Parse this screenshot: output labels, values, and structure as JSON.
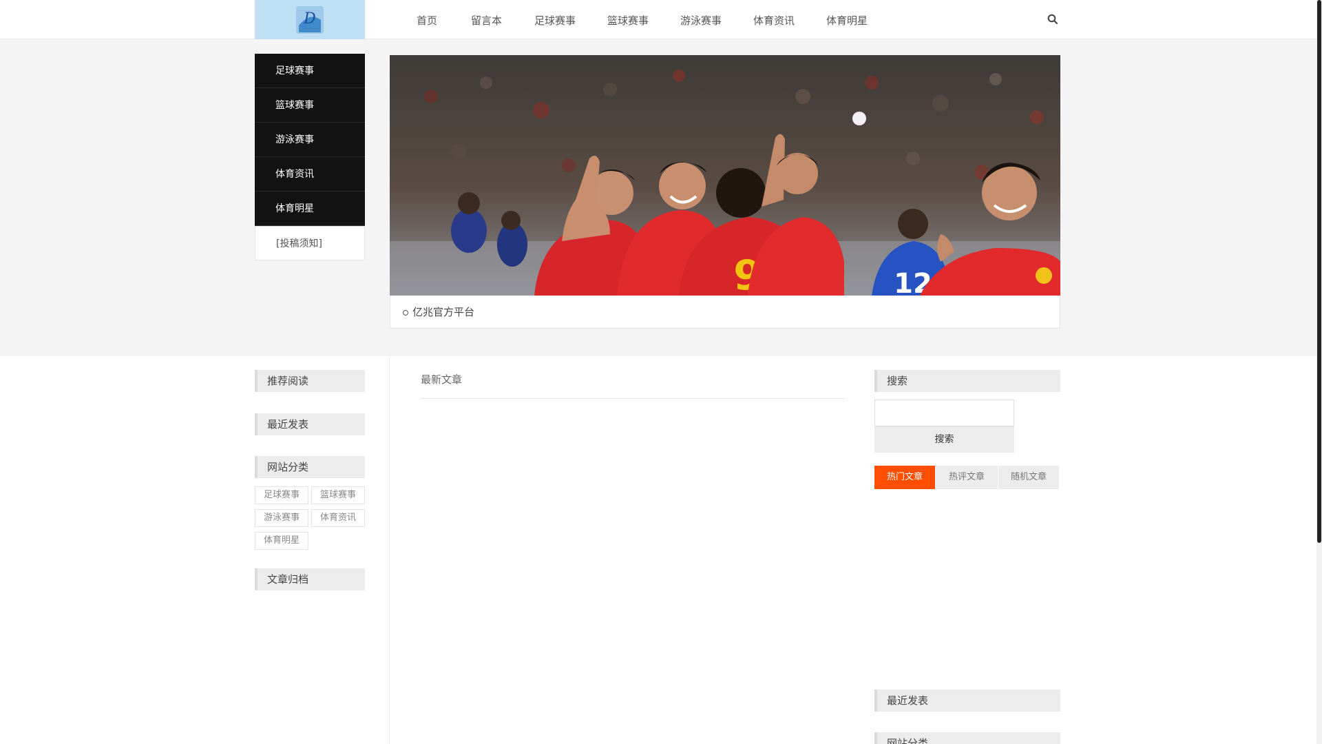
{
  "logo_text": "D",
  "nav": [
    "首页",
    "留言本",
    "足球赛事",
    "篮球赛事",
    "游泳赛事",
    "体育资讯",
    "体育明星"
  ],
  "menu": [
    "足球赛事",
    "篮球赛事",
    "游泳赛事",
    "体育资讯",
    "体育明星"
  ],
  "submit_notice": "[投稿须知]",
  "banner": {
    "caption": "亿兆官方平台",
    "jersey_numbers": [
      "9",
      "12"
    ]
  },
  "left_sidebar": {
    "recommended": "推荐阅读",
    "recent": "最近发表",
    "categories": "网站分类",
    "category_tags": [
      "足球赛事",
      "篮球赛事",
      "游泳赛事",
      "体育资讯",
      "体育明星"
    ],
    "archive": "文章归档"
  },
  "main": {
    "latest_title": "最新文章"
  },
  "right_sidebar": {
    "search_title": "搜索",
    "search_value": "",
    "search_button": "搜索",
    "tabs": [
      "热门文章",
      "热评文章",
      "随机文章"
    ],
    "active_tab": "热门文章",
    "recent": "最近发表",
    "categories": "网站分类"
  },
  "colors": {
    "accent": "#ff4e00",
    "menu_bg": "#121212",
    "band_bg": "#f4f4f4",
    "logo_bg": "#bfe0f4"
  }
}
